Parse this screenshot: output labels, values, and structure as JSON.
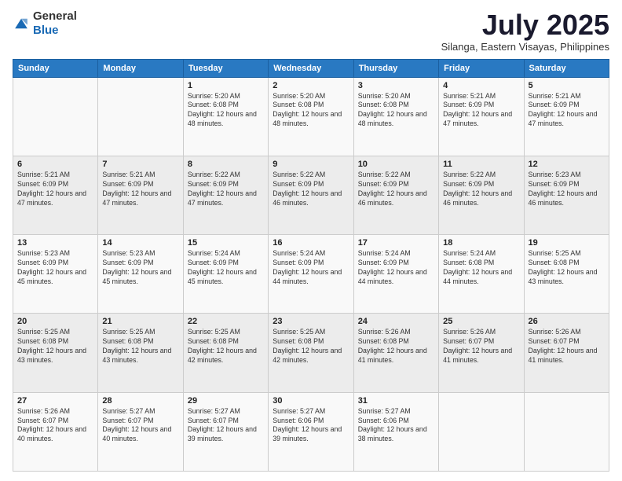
{
  "logo": {
    "general": "General",
    "blue": "Blue"
  },
  "title": "July 2025",
  "subtitle": "Silanga, Eastern Visayas, Philippines",
  "days_of_week": [
    "Sunday",
    "Monday",
    "Tuesday",
    "Wednesday",
    "Thursday",
    "Friday",
    "Saturday"
  ],
  "weeks": [
    [
      {
        "day": "",
        "sunrise": "",
        "sunset": "",
        "daylight": ""
      },
      {
        "day": "",
        "sunrise": "",
        "sunset": "",
        "daylight": ""
      },
      {
        "day": "1",
        "sunrise": "Sunrise: 5:20 AM",
        "sunset": "Sunset: 6:08 PM",
        "daylight": "Daylight: 12 hours and 48 minutes."
      },
      {
        "day": "2",
        "sunrise": "Sunrise: 5:20 AM",
        "sunset": "Sunset: 6:08 PM",
        "daylight": "Daylight: 12 hours and 48 minutes."
      },
      {
        "day": "3",
        "sunrise": "Sunrise: 5:20 AM",
        "sunset": "Sunset: 6:08 PM",
        "daylight": "Daylight: 12 hours and 48 minutes."
      },
      {
        "day": "4",
        "sunrise": "Sunrise: 5:21 AM",
        "sunset": "Sunset: 6:09 PM",
        "daylight": "Daylight: 12 hours and 47 minutes."
      },
      {
        "day": "5",
        "sunrise": "Sunrise: 5:21 AM",
        "sunset": "Sunset: 6:09 PM",
        "daylight": "Daylight: 12 hours and 47 minutes."
      }
    ],
    [
      {
        "day": "6",
        "sunrise": "Sunrise: 5:21 AM",
        "sunset": "Sunset: 6:09 PM",
        "daylight": "Daylight: 12 hours and 47 minutes."
      },
      {
        "day": "7",
        "sunrise": "Sunrise: 5:21 AM",
        "sunset": "Sunset: 6:09 PM",
        "daylight": "Daylight: 12 hours and 47 minutes."
      },
      {
        "day": "8",
        "sunrise": "Sunrise: 5:22 AM",
        "sunset": "Sunset: 6:09 PM",
        "daylight": "Daylight: 12 hours and 47 minutes."
      },
      {
        "day": "9",
        "sunrise": "Sunrise: 5:22 AM",
        "sunset": "Sunset: 6:09 PM",
        "daylight": "Daylight: 12 hours and 46 minutes."
      },
      {
        "day": "10",
        "sunrise": "Sunrise: 5:22 AM",
        "sunset": "Sunset: 6:09 PM",
        "daylight": "Daylight: 12 hours and 46 minutes."
      },
      {
        "day": "11",
        "sunrise": "Sunrise: 5:22 AM",
        "sunset": "Sunset: 6:09 PM",
        "daylight": "Daylight: 12 hours and 46 minutes."
      },
      {
        "day": "12",
        "sunrise": "Sunrise: 5:23 AM",
        "sunset": "Sunset: 6:09 PM",
        "daylight": "Daylight: 12 hours and 46 minutes."
      }
    ],
    [
      {
        "day": "13",
        "sunrise": "Sunrise: 5:23 AM",
        "sunset": "Sunset: 6:09 PM",
        "daylight": "Daylight: 12 hours and 45 minutes."
      },
      {
        "day": "14",
        "sunrise": "Sunrise: 5:23 AM",
        "sunset": "Sunset: 6:09 PM",
        "daylight": "Daylight: 12 hours and 45 minutes."
      },
      {
        "day": "15",
        "sunrise": "Sunrise: 5:24 AM",
        "sunset": "Sunset: 6:09 PM",
        "daylight": "Daylight: 12 hours and 45 minutes."
      },
      {
        "day": "16",
        "sunrise": "Sunrise: 5:24 AM",
        "sunset": "Sunset: 6:09 PM",
        "daylight": "Daylight: 12 hours and 44 minutes."
      },
      {
        "day": "17",
        "sunrise": "Sunrise: 5:24 AM",
        "sunset": "Sunset: 6:09 PM",
        "daylight": "Daylight: 12 hours and 44 minutes."
      },
      {
        "day": "18",
        "sunrise": "Sunrise: 5:24 AM",
        "sunset": "Sunset: 6:08 PM",
        "daylight": "Daylight: 12 hours and 44 minutes."
      },
      {
        "day": "19",
        "sunrise": "Sunrise: 5:25 AM",
        "sunset": "Sunset: 6:08 PM",
        "daylight": "Daylight: 12 hours and 43 minutes."
      }
    ],
    [
      {
        "day": "20",
        "sunrise": "Sunrise: 5:25 AM",
        "sunset": "Sunset: 6:08 PM",
        "daylight": "Daylight: 12 hours and 43 minutes."
      },
      {
        "day": "21",
        "sunrise": "Sunrise: 5:25 AM",
        "sunset": "Sunset: 6:08 PM",
        "daylight": "Daylight: 12 hours and 43 minutes."
      },
      {
        "day": "22",
        "sunrise": "Sunrise: 5:25 AM",
        "sunset": "Sunset: 6:08 PM",
        "daylight": "Daylight: 12 hours and 42 minutes."
      },
      {
        "day": "23",
        "sunrise": "Sunrise: 5:25 AM",
        "sunset": "Sunset: 6:08 PM",
        "daylight": "Daylight: 12 hours and 42 minutes."
      },
      {
        "day": "24",
        "sunrise": "Sunrise: 5:26 AM",
        "sunset": "Sunset: 6:08 PM",
        "daylight": "Daylight: 12 hours and 41 minutes."
      },
      {
        "day": "25",
        "sunrise": "Sunrise: 5:26 AM",
        "sunset": "Sunset: 6:07 PM",
        "daylight": "Daylight: 12 hours and 41 minutes."
      },
      {
        "day": "26",
        "sunrise": "Sunrise: 5:26 AM",
        "sunset": "Sunset: 6:07 PM",
        "daylight": "Daylight: 12 hours and 41 minutes."
      }
    ],
    [
      {
        "day": "27",
        "sunrise": "Sunrise: 5:26 AM",
        "sunset": "Sunset: 6:07 PM",
        "daylight": "Daylight: 12 hours and 40 minutes."
      },
      {
        "day": "28",
        "sunrise": "Sunrise: 5:27 AM",
        "sunset": "Sunset: 6:07 PM",
        "daylight": "Daylight: 12 hours and 40 minutes."
      },
      {
        "day": "29",
        "sunrise": "Sunrise: 5:27 AM",
        "sunset": "Sunset: 6:07 PM",
        "daylight": "Daylight: 12 hours and 39 minutes."
      },
      {
        "day": "30",
        "sunrise": "Sunrise: 5:27 AM",
        "sunset": "Sunset: 6:06 PM",
        "daylight": "Daylight: 12 hours and 39 minutes."
      },
      {
        "day": "31",
        "sunrise": "Sunrise: 5:27 AM",
        "sunset": "Sunset: 6:06 PM",
        "daylight": "Daylight: 12 hours and 38 minutes."
      },
      {
        "day": "",
        "sunrise": "",
        "sunset": "",
        "daylight": ""
      },
      {
        "day": "",
        "sunrise": "",
        "sunset": "",
        "daylight": ""
      }
    ]
  ]
}
